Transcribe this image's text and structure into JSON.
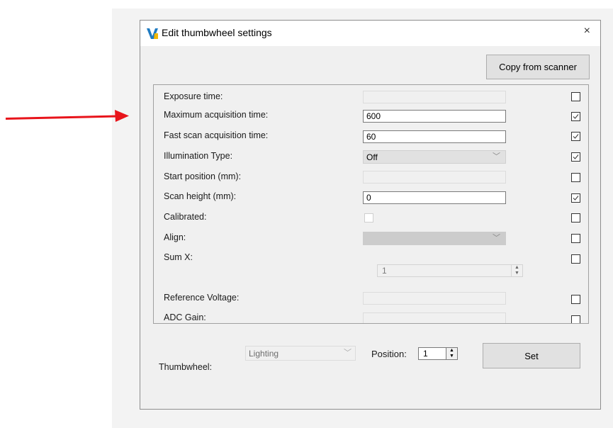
{
  "dialog": {
    "title": "Edit thumbwheel settings",
    "close_glyph": "×",
    "copy_button_label": "Copy from scanner"
  },
  "settings": [
    {
      "label": "Exposure time:",
      "value": "",
      "control": "text",
      "enabled": false,
      "checked": false
    },
    {
      "label": "Maximum acquisition time:",
      "value": "600",
      "control": "text",
      "enabled": true,
      "checked": true
    },
    {
      "label": "Fast scan acquisition time:",
      "value": "60",
      "control": "text",
      "enabled": true,
      "checked": true
    },
    {
      "label": "Illumination Type:",
      "value": "Off",
      "control": "dropdown",
      "enabled": true,
      "checked": true
    },
    {
      "label": "Start position (mm):",
      "value": "",
      "control": "text",
      "enabled": false,
      "checked": false
    },
    {
      "label": "Scan height (mm):",
      "value": "0",
      "control": "text",
      "enabled": true,
      "checked": true
    },
    {
      "label": "Calibrated:",
      "value": "",
      "control": "checkbox",
      "enabled": false,
      "checked": false
    },
    {
      "label": "Align:",
      "value": "",
      "control": "dropdown",
      "enabled": false,
      "checked": false
    },
    {
      "label": "Sum X:",
      "value": "1",
      "control": "spinner",
      "enabled": false,
      "checked": false
    },
    {
      "label": "Reference Voltage:",
      "value": "",
      "control": "text",
      "enabled": false,
      "checked": false
    },
    {
      "label": "ADC Gain:",
      "value": "",
      "control": "text",
      "enabled": false,
      "checked": false
    }
  ],
  "footer": {
    "thumbwheel_label": "Thumbwheel:",
    "thumbwheel_value": "Lighting",
    "position_label": "Position:",
    "position_value": "1",
    "set_button_label": "Set"
  },
  "colors": {
    "arrow": "#e8141b",
    "logo_blue": "#1f7bc2",
    "logo_yellow": "#f2b705"
  },
  "icons": [
    "app-logo-icon",
    "close-icon",
    "red-arrow",
    "chevron-down-icon",
    "checkmark-icon",
    "spinner-arrows-icon"
  ]
}
